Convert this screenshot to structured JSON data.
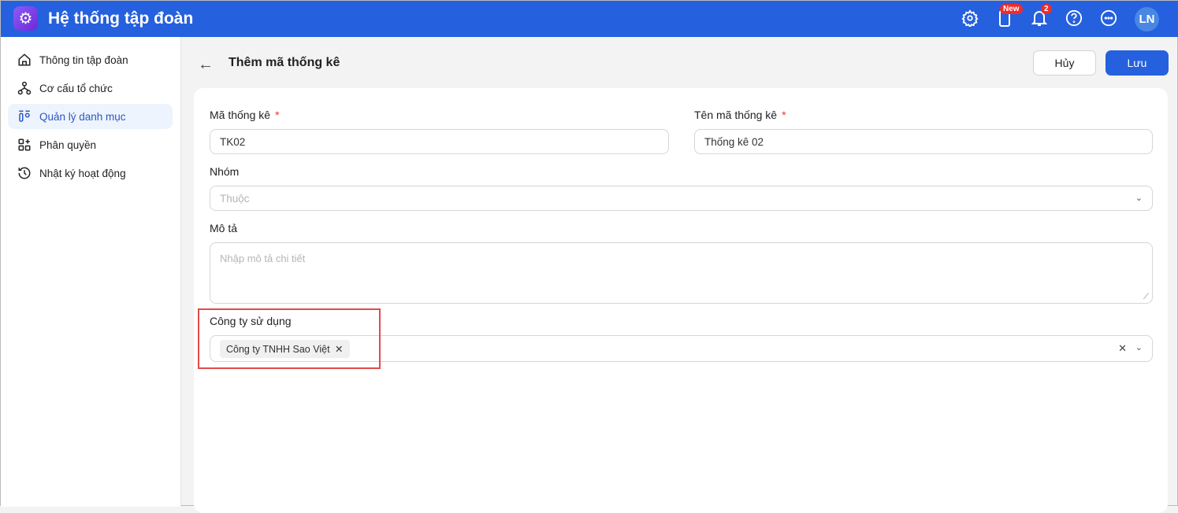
{
  "header": {
    "title": "Hệ thống tập đoàn",
    "new_badge": "New",
    "notif_count": "2",
    "avatar": "LN"
  },
  "sidebar": {
    "items": [
      {
        "label": "Thông tin tập đoàn"
      },
      {
        "label": "Cơ cấu tổ chức"
      },
      {
        "label": "Quản lý danh mục"
      },
      {
        "label": "Phân quyền"
      },
      {
        "label": "Nhật ký hoạt động"
      }
    ]
  },
  "page": {
    "title": "Thêm mã thống kê",
    "cancel": "Hủy",
    "save": "Lưu"
  },
  "form": {
    "code_label": "Mã thống kê",
    "code_value": "TK02",
    "name_label": "Tên mã thống kê",
    "name_value": "Thống kê 02",
    "required": "*",
    "group_label": "Nhóm",
    "group_placeholder": "Thuộc",
    "desc_label": "Mô tả",
    "desc_placeholder": "Nhập mô tả chi tiết",
    "company_label": "Công ty sử dụng",
    "company_tag": "Công ty TNHH Sao Việt"
  }
}
